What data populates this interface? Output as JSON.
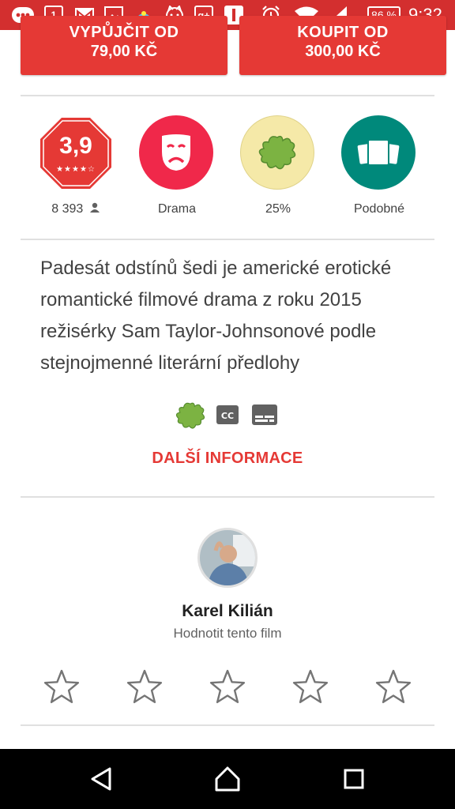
{
  "status_bar": {
    "calendar_day": "1",
    "battery": "86 %",
    "time": "9:32"
  },
  "purchase": {
    "rent_label": "VYPŮJČIT OD",
    "rent_price": "79,00 KČ",
    "buy_label": "KOUPIT OD",
    "buy_price": "300,00 KČ"
  },
  "badges": {
    "rating_value": "3,9",
    "rating_stars": 3.9,
    "votes": "8 393",
    "genre": "Drama",
    "freshness": "25%",
    "similar": "Podobné"
  },
  "description": "Padesát odstínů šedi je americké erotické romantické filmové drama z roku 2015 režisérky Sam Taylor-Johnsonové podle stejnojmenné literární předlohy",
  "more_info": "DALŠÍ INFORMACE",
  "user": {
    "name": "Karel Kilián",
    "prompt": "Hodnotit tento film"
  },
  "colors": {
    "accent": "#e53935",
    "status_bar": "#d32f2f",
    "genre_circle": "#f0284a",
    "freshness_circle": "#f5e9a8",
    "similar_circle": "#00897b"
  },
  "icons": [
    "notification-icon",
    "calendar-icon",
    "gmail-icon",
    "gallery-icon",
    "weather-icon",
    "cat-icon",
    "google-plus-icon",
    "app-icon",
    "alarm-icon",
    "wifi-icon",
    "signal-icon"
  ]
}
